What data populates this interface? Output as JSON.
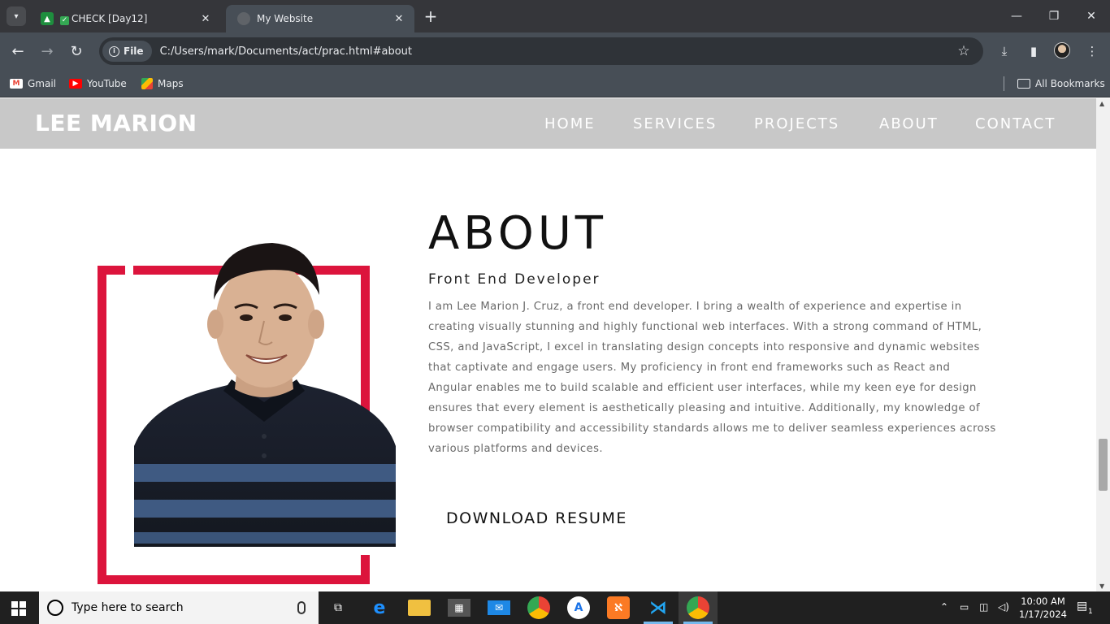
{
  "browser": {
    "tabs": [
      {
        "title": "CHECK [Day12]",
        "favicon": "google-classroom-icon"
      },
      {
        "title": "My Website",
        "favicon": "globe-icon",
        "active": true
      }
    ],
    "url_scheme_label": "File",
    "url": "C:/Users/mark/Documents/act/prac.html#about",
    "bookmarks": [
      {
        "label": "Gmail",
        "icon": "gmail-icon"
      },
      {
        "label": "YouTube",
        "icon": "youtube-icon"
      },
      {
        "label": "Maps",
        "icon": "maps-icon"
      }
    ],
    "all_bookmarks_label": "All Bookmarks"
  },
  "site": {
    "logo": "LEE MARION",
    "nav": [
      "HOME",
      "SERVICES",
      "PROJECTS",
      "ABOUT",
      "CONTACT"
    ],
    "accent_color": "#dc143c",
    "nav_bg_color": "#c8c8c8"
  },
  "about": {
    "title": "ABOUT",
    "subtitle": "Front End Developer",
    "body": "I am Lee Marion J. Cruz, a front end developer. I bring a wealth of experience and expertise in creating visually stunning and highly functional web interfaces. With a strong command of HTML, CSS, and JavaScript, I excel in translating design concepts into responsive and dynamic websites that captivate and engage users. My proficiency in front end frameworks such as React and Angular enables me to build scalable and efficient user interfaces, while my keen eye for design ensures that every element is aesthetically pleasing and intuitive. Additionally, my knowledge of browser compatibility and accessibility standards allows me to deliver seamless experiences across various platforms and devices.",
    "resume_button": "DOWNLOAD RESUME"
  },
  "taskbar": {
    "search_placeholder": "Type here to search",
    "time": "10:00 AM",
    "date": "1/17/2024",
    "notification_count": "1"
  }
}
